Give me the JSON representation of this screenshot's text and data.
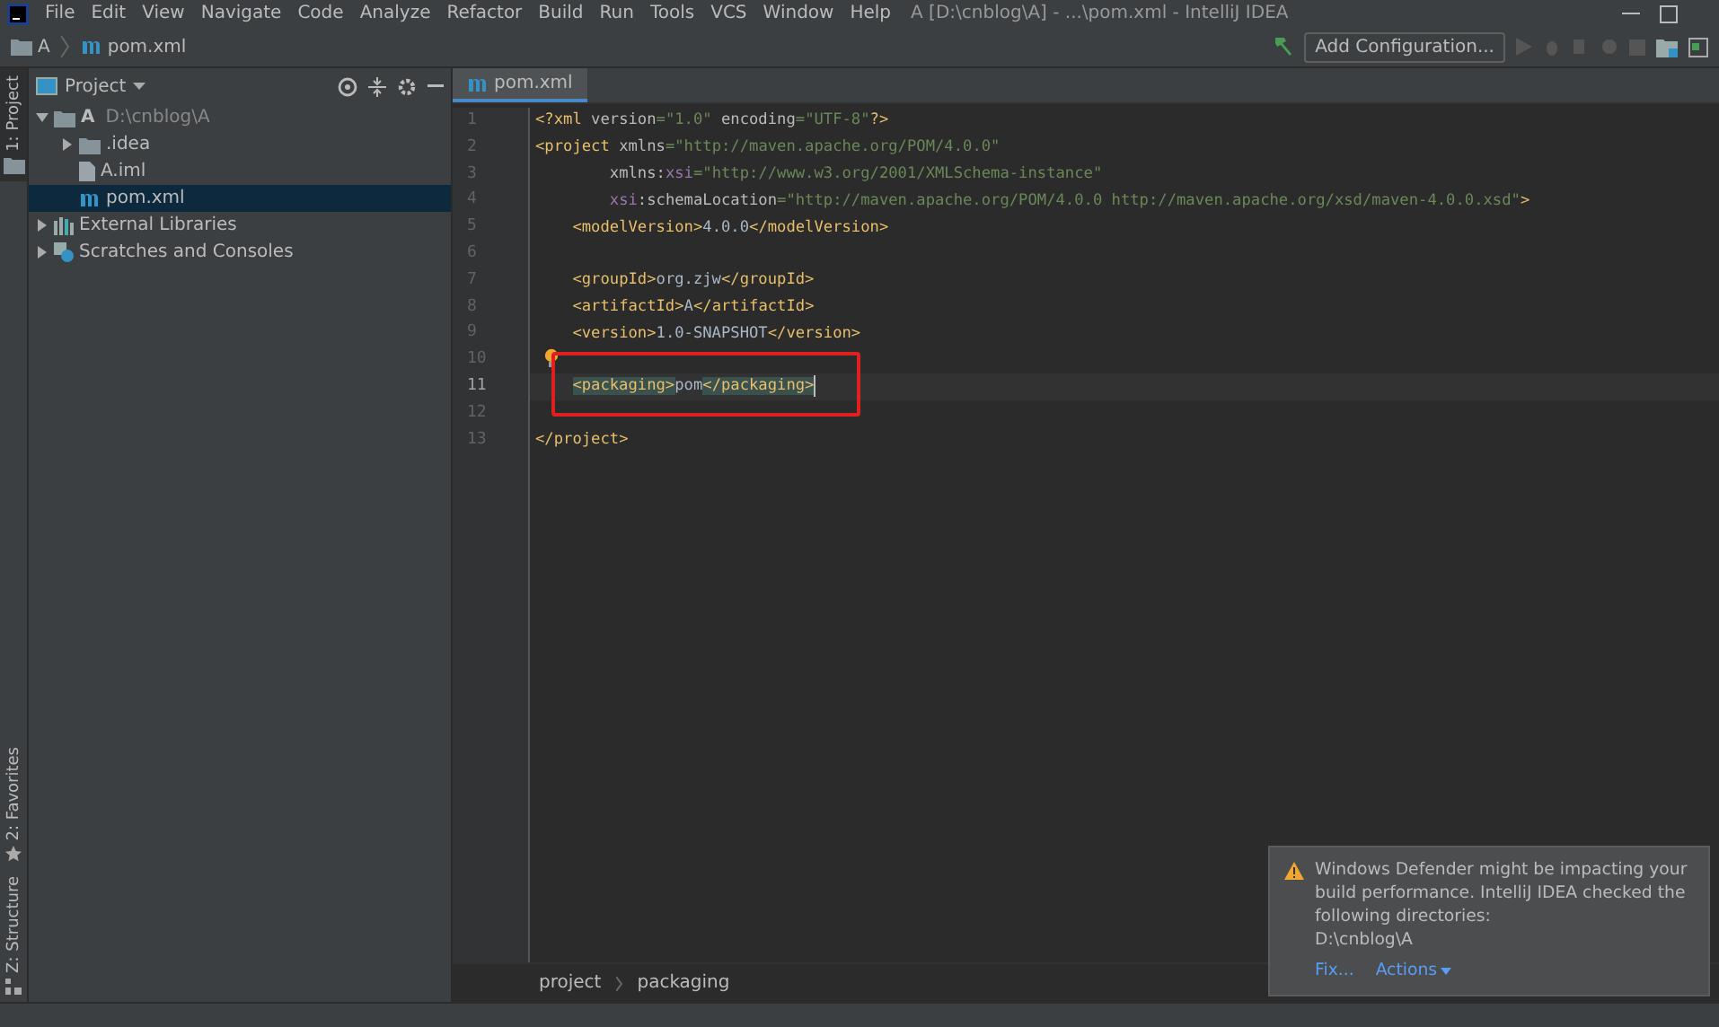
{
  "menu": [
    "File",
    "Edit",
    "View",
    "Navigate",
    "Code",
    "Analyze",
    "Refactor",
    "Build",
    "Run",
    "Tools",
    "VCS",
    "Window",
    "Help"
  ],
  "window": {
    "title": "A [D:\\cnblog\\A] - ...\\pom.xml - IntelliJ IDEA"
  },
  "navbar": {
    "crumbs": [
      {
        "label": "A",
        "kind": "folder"
      },
      {
        "label": "pom.xml",
        "kind": "maven"
      }
    ],
    "run_config": "Add Configuration..."
  },
  "left_stripe": [
    {
      "label": "1: Project",
      "selected": true,
      "kind": "folder"
    },
    {
      "label": "2: Favorites",
      "selected": false,
      "kind": "star"
    },
    {
      "label": "Z: Structure",
      "selected": false,
      "kind": "structure"
    }
  ],
  "project_panel": {
    "title": "Project",
    "tree": [
      {
        "label": "A",
        "path": "D:\\cnblog\\A",
        "kind": "module",
        "expanded": true,
        "selected": false,
        "children": [
          {
            "label": ".idea",
            "kind": "folder",
            "expanded": false,
            "selected": false
          },
          {
            "label": "A.iml",
            "kind": "file",
            "selected": false
          },
          {
            "label": "pom.xml",
            "kind": "maven",
            "selected": true
          }
        ]
      },
      {
        "label": "External Libraries",
        "kind": "library",
        "expanded": false,
        "selected": false
      },
      {
        "label": "Scratches and Consoles",
        "kind": "scratch",
        "expanded": false,
        "selected": false
      }
    ]
  },
  "editor": {
    "tabs": [
      {
        "label": "pom.xml",
        "selected": true
      }
    ],
    "lines": [
      {
        "number": "1",
        "segments": [
          {
            "kind": "tag",
            "text": "<?xml "
          },
          {
            "kind": "attr",
            "text": "version"
          },
          {
            "kind": "value",
            "text": "=\"1.0\" "
          },
          {
            "kind": "attr",
            "text": "encoding"
          },
          {
            "kind": "value",
            "text": "=\"UTF-8\""
          },
          {
            "kind": "tag",
            "text": "?>"
          }
        ]
      },
      {
        "number": "2",
        "segments": [
          {
            "kind": "tag",
            "text": "<project "
          },
          {
            "kind": "attr",
            "text": "xmlns"
          },
          {
            "kind": "value",
            "text": "=\"http://maven.apache.org/POM/4.0.0\""
          }
        ]
      },
      {
        "number": "3",
        "segments": [
          {
            "kind": "attr",
            "text": "        xmlns:"
          },
          {
            "kind": "ns",
            "text": "xsi"
          },
          {
            "kind": "value",
            "text": "=\"http://www.w3.org/2001/XMLSchema-instance\""
          }
        ]
      },
      {
        "number": "4",
        "segments": [
          {
            "kind": "ns",
            "text": "        xsi"
          },
          {
            "kind": "attr",
            "text": ":schemaLocation"
          },
          {
            "kind": "value",
            "text": "=\"http://maven.apache.org/POM/4.0.0 http://maven.apache.org/xsd/maven-4.0.0.xsd\""
          },
          {
            "kind": "tag",
            "text": ">"
          }
        ]
      },
      {
        "number": "5",
        "segments": [
          {
            "kind": "tag",
            "text": "    <modelVersion>"
          },
          {
            "kind": "text",
            "text": "4.0.0"
          },
          {
            "kind": "tag",
            "text": "</modelVersion>"
          }
        ]
      },
      {
        "number": "6"
      },
      {
        "number": "7",
        "segments": [
          {
            "kind": "tag",
            "text": "    <groupId>"
          },
          {
            "kind": "text",
            "text": "org.zjw"
          },
          {
            "kind": "tag",
            "text": "</groupId>"
          }
        ]
      },
      {
        "number": "8",
        "segments": [
          {
            "kind": "tag",
            "text": "    <artifactId>"
          },
          {
            "kind": "text",
            "text": "A"
          },
          {
            "kind": "tag",
            "text": "</artifactId>"
          }
        ]
      },
      {
        "number": "9",
        "segments": [
          {
            "kind": "tag",
            "text": "    <version>"
          },
          {
            "kind": "text",
            "text": "1.0-SNAPSHOT"
          },
          {
            "kind": "tag",
            "text": "</version>"
          }
        ]
      },
      {
        "number": "10",
        "bulb": true
      },
      {
        "number": "11",
        "current": true,
        "indented": true,
        "segments": [
          {
            "kind": "matched",
            "text": "<packaging>"
          },
          {
            "kind": "text",
            "text": "pom"
          },
          {
            "kind": "matched",
            "text": "</packaging>"
          }
        ]
      },
      {
        "number": "12"
      },
      {
        "number": "13",
        "segments": [
          {
            "kind": "tag",
            "text": "</project>"
          }
        ]
      }
    ],
    "breadcrumbs": [
      "project",
      "packaging"
    ]
  },
  "notification": {
    "message": "Windows Defender might be impacting your build performance. IntelliJ IDEA checked the following directories:",
    "path": "D:\\cnblog\\A",
    "actions": [
      "Fix...",
      "Actions"
    ]
  }
}
